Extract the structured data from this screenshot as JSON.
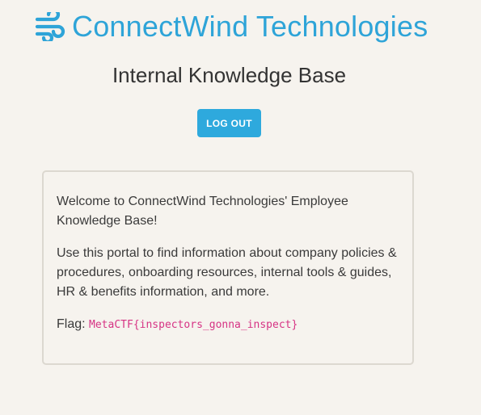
{
  "header": {
    "brand_name": "ConnectWind Technologies",
    "brand_icon": "wind-icon",
    "subtitle": "Internal Knowledge Base"
  },
  "actions": {
    "logout_label": "LOG OUT"
  },
  "card": {
    "welcome_text": "Welcome to ConnectWind Technologies' Employee Knowledge Base!",
    "description_text": "Use this portal to find information about company policies & procedures, onboarding resources, internal tools & guides, HR & benefits information, and more.",
    "flag_label": "Flag:",
    "flag_value": "MetaCTF{inspectors_gonna_inspect}"
  },
  "colors": {
    "brand": "#2ea4d8",
    "button": "#2ea9dd",
    "background": "#f6f3ee",
    "card_border": "#dcd8d0",
    "flag_code": "#d63384"
  }
}
